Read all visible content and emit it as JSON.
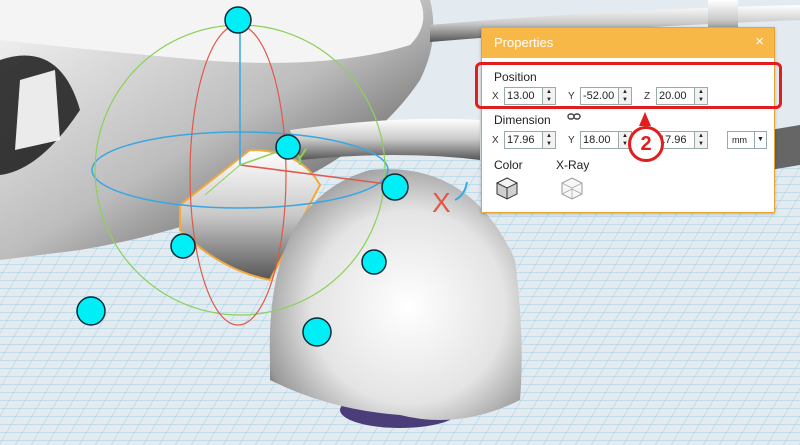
{
  "panel": {
    "title": "Properties",
    "close_label": "×",
    "position": {
      "label": "Position",
      "x_label": "X",
      "x_value": "13.00",
      "y_label": "Y",
      "y_value": "-52.00",
      "z_label": "Z",
      "z_value": "20.00"
    },
    "dimension": {
      "label": "Dimension",
      "x_label": "X",
      "x_value": "17.96",
      "y_label": "Y",
      "y_value": "18.00",
      "z_value": "17.96",
      "unit": "mm"
    },
    "color_label": "Color",
    "xray_label": "X-Ray"
  },
  "callout": {
    "number": "2"
  },
  "gizmo": {
    "x_axis_label": "X",
    "y_axis_label": "Y"
  },
  "colors": {
    "accent": "#f7b847",
    "highlight": "#e21d1d",
    "handle": "#00e5f0"
  }
}
